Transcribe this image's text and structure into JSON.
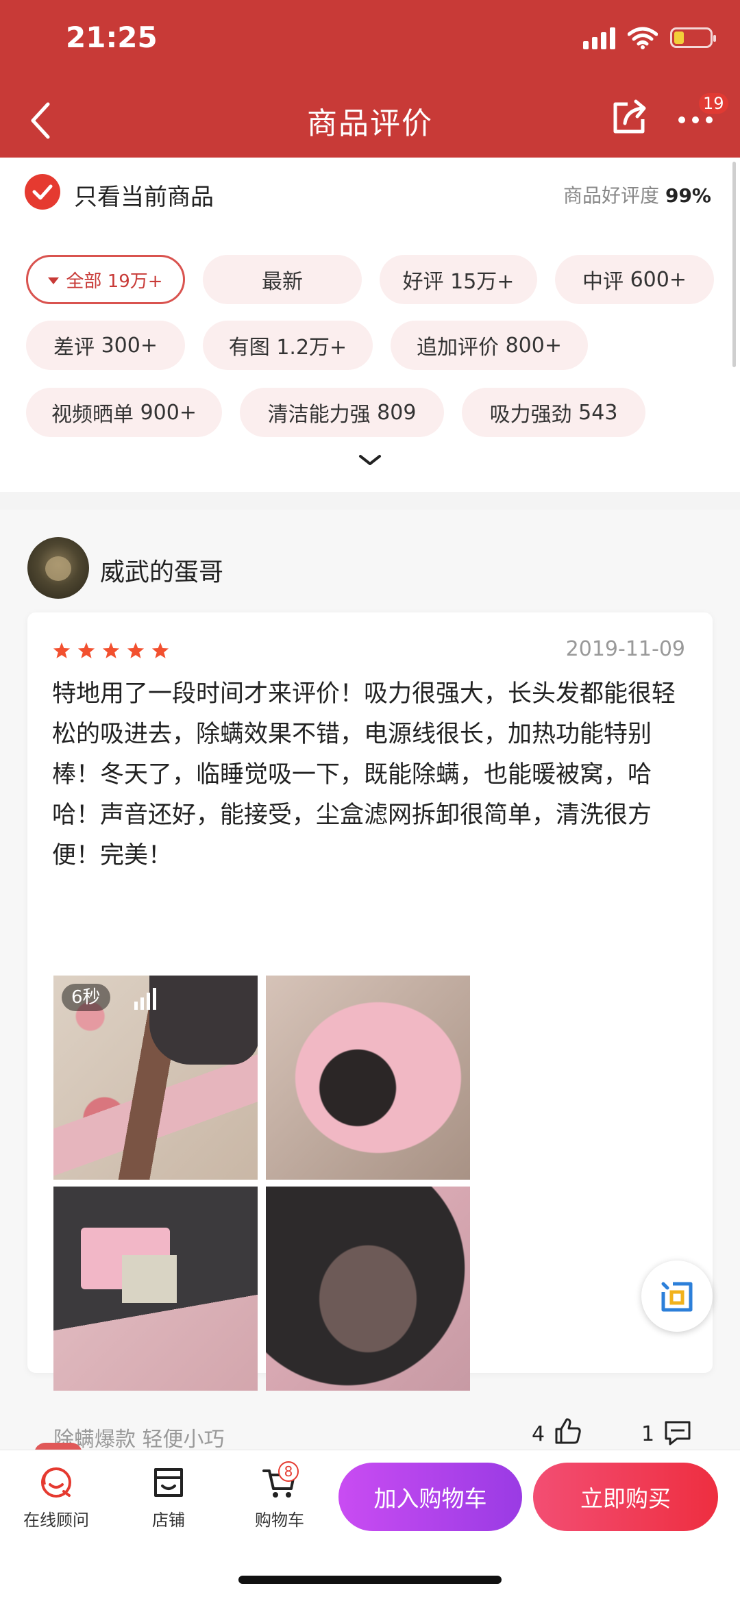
{
  "status_bar": {
    "time": "21:25"
  },
  "header": {
    "title": "商品评价",
    "more_badge": "19"
  },
  "filter": {
    "only_current_label": "只看当前商品",
    "rating_prefix": "商品好评度",
    "rating_value": "99%",
    "tags": [
      {
        "label": "全部",
        "count": "19万+"
      },
      {
        "label": "最新",
        "count": ""
      },
      {
        "label": "好评",
        "count": "15万+"
      },
      {
        "label": "中评",
        "count": "600+"
      },
      {
        "label": "差评",
        "count": "300+"
      },
      {
        "label": "有图",
        "count": "1.2万+"
      },
      {
        "label": "追加评价",
        "count": "800+"
      },
      {
        "label": "视频晒单",
        "count": "900+"
      },
      {
        "label": "清洁能力强",
        "count": "809"
      },
      {
        "label": "吸力强劲",
        "count": "543"
      }
    ]
  },
  "review": {
    "username": "威武的蛋哥",
    "rating": 5,
    "date": "2019-11-09",
    "text": "特地用了一段时间才来评价！吸力很强大，长头发都能很轻松的吸进去，除螨效果不错，电源线很长，加热功能特别棒！冬天了，临睡觉吸一下，既能除螨，也能暖被窝，哈哈！声音还好，能接受，尘盒滤网拆卸很简单，清洗很方便！完美！",
    "video_duration": "6秒",
    "product_tags": "除螨爆款 轻便小巧",
    "likes": "4",
    "comments": "1"
  },
  "bottom_bar": {
    "consult_label": "在线顾问",
    "store_label": "店铺",
    "cart_label": "购物车",
    "cart_badge": "8",
    "add_to_cart": "加入购物车",
    "buy_now": "立即购买"
  },
  "colors": {
    "header": "#c83a37",
    "accent": "#e53a30",
    "cart_button": "#b044ea",
    "buy_button": "#f03b55"
  }
}
